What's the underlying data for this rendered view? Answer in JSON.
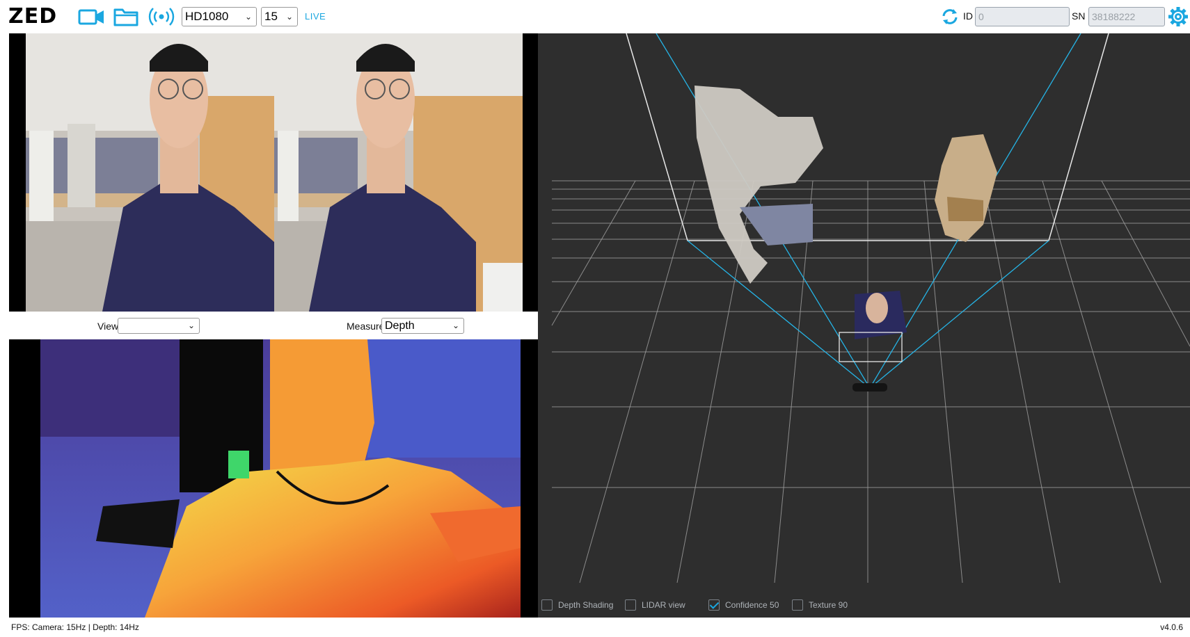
{
  "app": {
    "logo": "ZED"
  },
  "toolbar": {
    "camera_icon": "video-camera-icon",
    "folder_icon": "folder-icon",
    "stream_icon": "broadcast-icon",
    "resolution": "HD1080",
    "fps": "15",
    "live_label": "LIVE",
    "refresh_icon": "refresh-icon",
    "id_label": "ID",
    "id_value": "0",
    "sn_label": "SN",
    "sn_value": "38188222",
    "settings_icon": "gear-icon",
    "accent_color": "#1aa7e0"
  },
  "view_controls": {
    "view_label": "View",
    "view_value": "",
    "measure_label": "Measure",
    "measure_value": "Depth"
  },
  "options": [
    {
      "label": "Depth Shading",
      "checked": false
    },
    {
      "label": "LIDAR view",
      "checked": false
    },
    {
      "label": "Confidence 50",
      "checked": true
    },
    {
      "label": "Texture 90",
      "checked": false
    }
  ],
  "status": {
    "fps_text": "FPS: Camera: 15Hz | Depth: 14Hz",
    "version": "v4.0.6"
  }
}
